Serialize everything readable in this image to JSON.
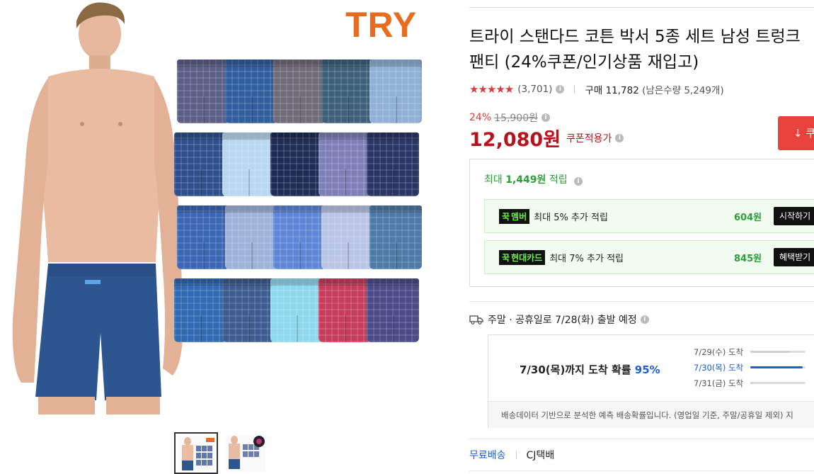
{
  "gallery": {
    "brand_logo": "TRY",
    "boxer_colors": [
      [
        "#5b5f86",
        "#2f5d9e",
        "#6f6b79",
        "#3c5f7a",
        "#8fb1d6"
      ],
      [
        "#2f4f8c",
        "#b8d7f0",
        "#1e2d55",
        "#7f7fb8",
        "#2a3566"
      ],
      [
        "#3b66b4",
        "#9fb2d9",
        "#5d86d6",
        "#b9c5e6",
        "#4d7aa7"
      ],
      [
        "#2e69b1",
        "#3d5b8e",
        "#8ed8ee",
        "#c63d5c",
        "#4a4b87"
      ]
    ]
  },
  "product": {
    "title": "트라이 스탠다드 코튼 박서 5종 세트 남성 트렁크 팬티 (24%쿠폰/인기상품 재입고)",
    "stars": "★★★★★",
    "review_count": "(3,701)",
    "purchase_label": "구매 11,782",
    "stock_label": "(남은수량 5,249개)",
    "discount_rate": "24%",
    "original_price": "15,900원",
    "price": "12,080원",
    "coupon_applied": "쿠폰적용가",
    "coupon_button": "↓ 쿠"
  },
  "rewards": {
    "title_prefix": "최대",
    "title_amount": "1,449원",
    "title_suffix": "적립",
    "rows": [
      {
        "tag": "멤버",
        "text": "최대 5% 추가 적립",
        "amount": "604원",
        "button": "시작하기"
      },
      {
        "tag": "현대카드",
        "text": "최대 7% 추가 적립",
        "amount": "845원",
        "button": "혜택받기"
      }
    ]
  },
  "shipping": {
    "notice": "주말 · 공휴일로 7/28(화) 출발 예정",
    "arrival_prefix": "7/30(목)까지 도착 확률",
    "arrival_percent": "95%",
    "options": [
      {
        "label": "7/29(수) 도착",
        "pct": 0.72,
        "color": "#cfcfcf"
      },
      {
        "label": "7/30(목) 도착",
        "pct": 0.95,
        "color": "#1b5ed1"
      },
      {
        "label": "7/31(금) 도착",
        "pct": 0.05,
        "color": "#cfcfcf"
      }
    ],
    "footnote": "배송데이터 기반으로 분석한 예측 배송확률입니다. (영업일 기준, 주말/공휴일 제외) 지",
    "free_delivery": "무료배송",
    "courier": "CJ택배"
  }
}
